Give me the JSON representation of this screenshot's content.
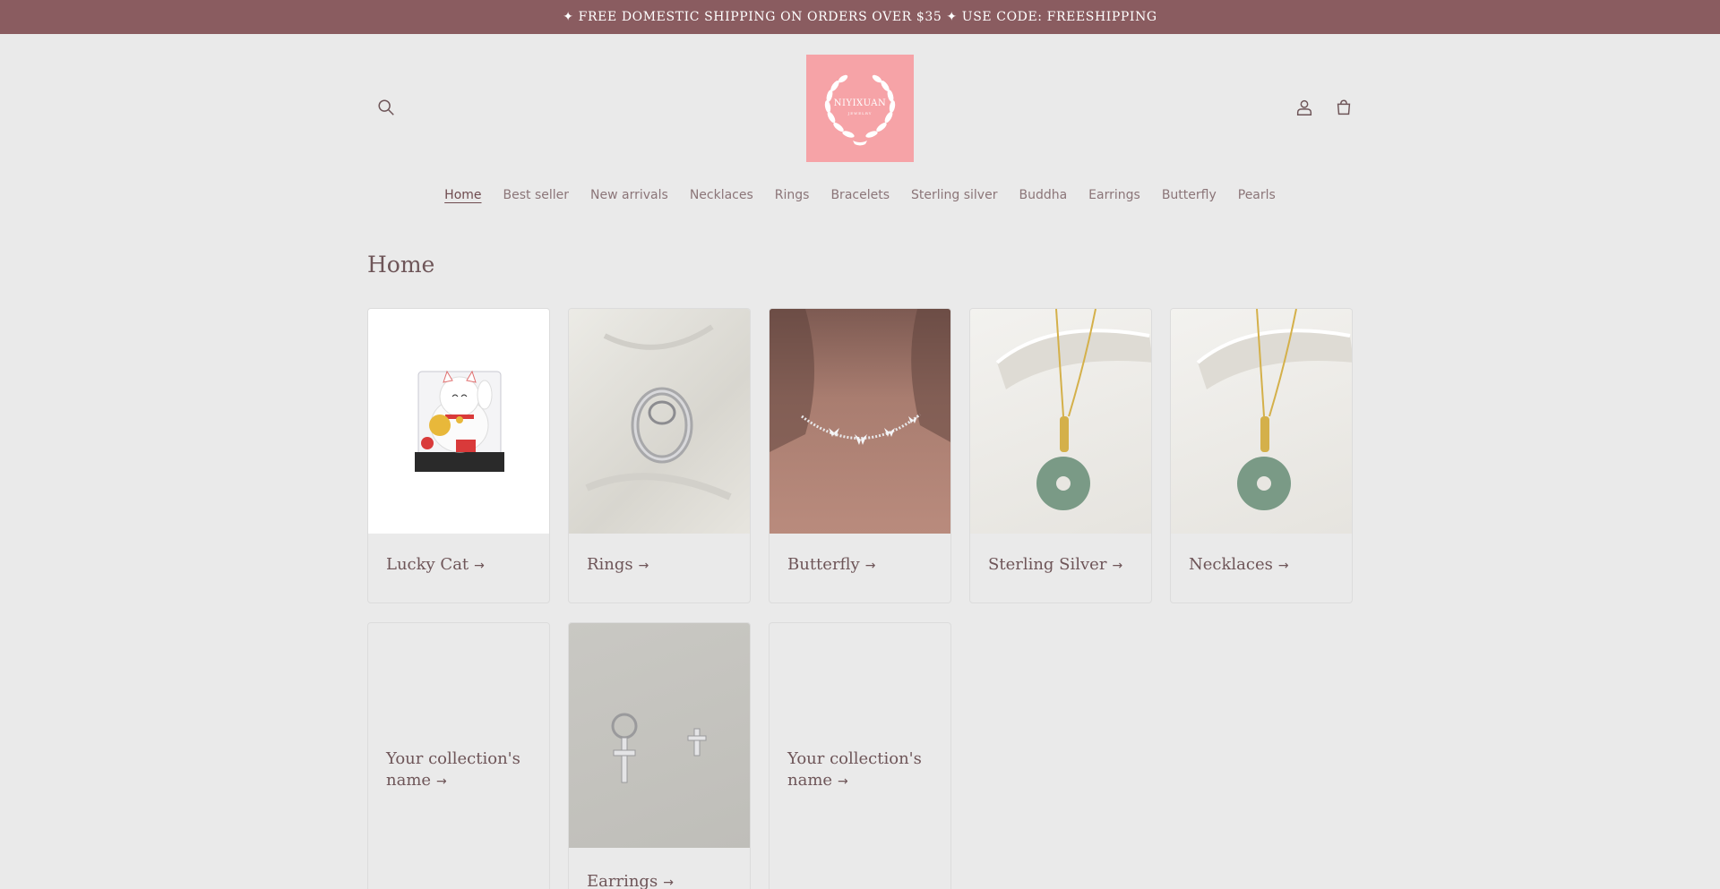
{
  "announcement": "✦ FREE DOMESTIC SHIPPING ON ORDERS OVER $35 ✦ USE CODE: FREESHIPPING",
  "brand": {
    "name": "NIYIXUAN",
    "tagline": "JEWELRY",
    "logo_bg": "#f6a3a7"
  },
  "header": {
    "search_icon": "search-icon",
    "account_icon": "account-icon",
    "cart_icon": "cart-icon"
  },
  "nav": [
    "Home",
    "Best seller",
    "New arrivals",
    "Necklaces",
    "Rings",
    "Bracelets",
    "Sterling silver",
    "Buddha",
    "Earrings",
    "Butterfly",
    "Pearls"
  ],
  "nav_active": "Home",
  "page_title": "Home",
  "collections": [
    {
      "title": "Lucky Cat",
      "image": "lucky-cat-figurine"
    },
    {
      "title": "Rings",
      "image": "silver-ring"
    },
    {
      "title": "Butterfly",
      "image": "butterfly-choker"
    },
    {
      "title": "Sterling Silver",
      "image": "jade-pendant-necklace"
    },
    {
      "title": "Necklaces",
      "image": "jade-pendant-necklace"
    },
    {
      "title": "Your collection's name",
      "image": ""
    },
    {
      "title": "Earrings",
      "image": "cross-earrings"
    },
    {
      "title": "Your collection's name",
      "image": ""
    }
  ],
  "colors": {
    "announcement_bg": "#8a5c60",
    "page_bg": "#eaeaea",
    "text": "#6e5558"
  }
}
